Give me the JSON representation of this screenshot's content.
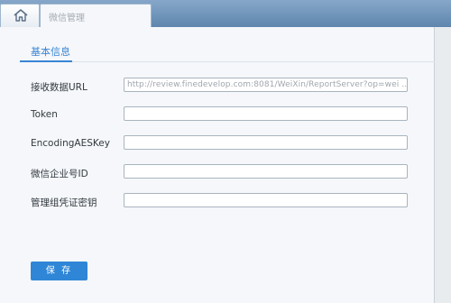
{
  "tabs": [
    {
      "icon": "home-icon"
    },
    {
      "label": "微信管理"
    }
  ],
  "section": {
    "title": "基本信息"
  },
  "form": {
    "rows": [
      {
        "label": "接收数据URL",
        "value": "http://review.finedevelop.com:8081/WeiXin/ReportServer?op=wei ..."
      },
      {
        "label": "Token",
        "value": ""
      },
      {
        "label": "EncodingAESKey",
        "value": ""
      },
      {
        "label": "微信企业号ID",
        "value": ""
      },
      {
        "label": "管理组凭证密钥",
        "value": ""
      }
    ]
  },
  "actions": {
    "save_label": "保 存"
  },
  "colors": {
    "accent": "#3985d4",
    "button": "#2f86d6",
    "tabbar": "#6f94bb"
  }
}
